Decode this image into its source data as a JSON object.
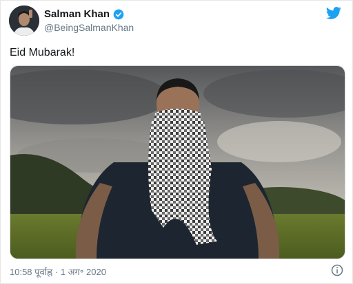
{
  "tweet": {
    "author_name": "Salman Khan",
    "handle": "@BeingSalmanKhan",
    "text": "Eid Mubarak!",
    "timestamp": "10:58 पूर्वाह्न · 1 अग॰ 2020"
  },
  "icons": {
    "verified": "verified-badge-icon",
    "brand": "twitter-bird-icon",
    "info": "info-icon"
  },
  "colors": {
    "brand_blue": "#1da1f2",
    "name_text": "#14171a",
    "secondary_text": "#657786"
  }
}
